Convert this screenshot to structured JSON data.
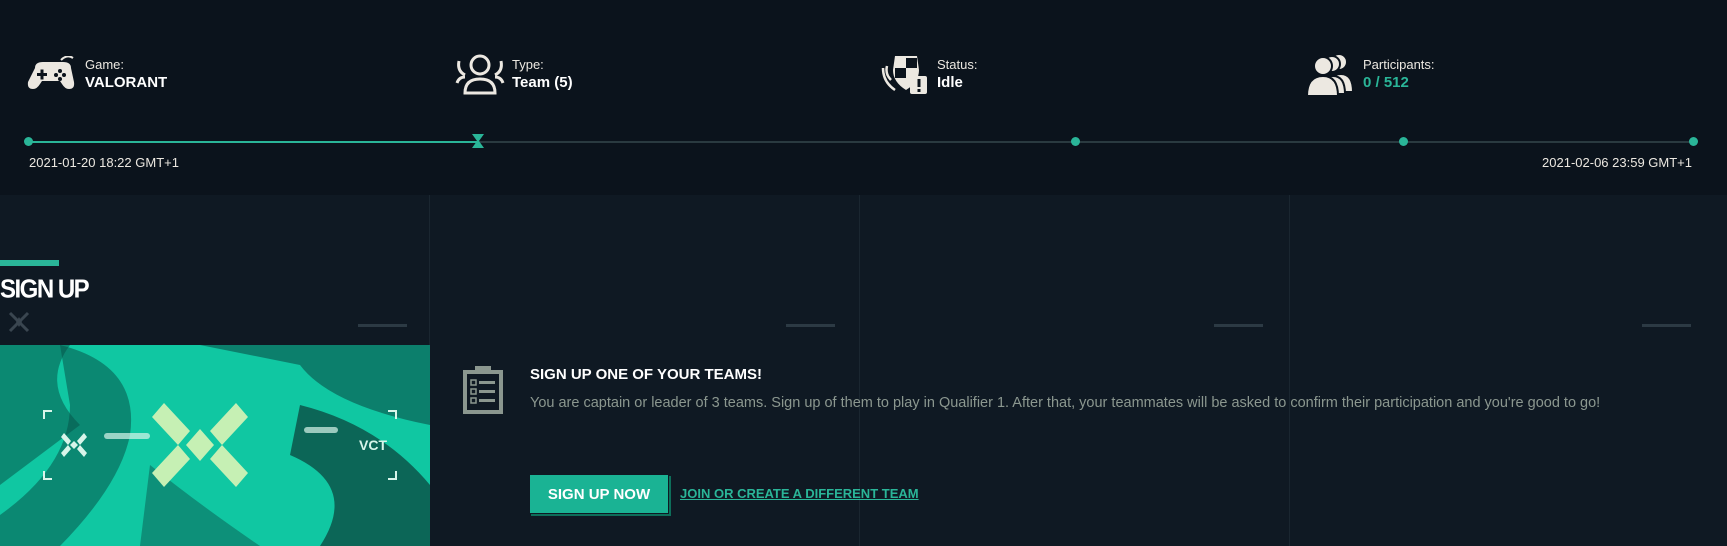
{
  "stats": {
    "game": {
      "label": "Game:",
      "value": "VALORANT",
      "icon": "gamepad-icon"
    },
    "type": {
      "label": "Type:",
      "value": "Team (5)",
      "icon": "team-icon"
    },
    "status": {
      "label": "Status:",
      "value": "Idle",
      "icon": "shield-warning-icon"
    },
    "participants": {
      "label": "Participants:",
      "value": "0 / 512",
      "icon": "participants-icon"
    }
  },
  "timeline": {
    "start": "2021-01-20 18:22 GMT+1",
    "end": "2021-02-06 23:59 GMT+1",
    "progress": 0.27
  },
  "signup": {
    "heading": "SIGN UP",
    "banner_text": "VCT",
    "cta_title": "SIGN UP ONE OF YOUR TEAMS!",
    "cta_description": "You are captain or leader of 3 teams. Sign up of them to play in Qualifier 1. After that, your teammates will be asked to confirm their participation and you're good to go!",
    "button_label": "SIGN UP NOW",
    "link_label": "JOIN OR CREATE A DIFFERENT TEAM"
  },
  "colors": {
    "accent": "#2ab598",
    "background": "#0f1923",
    "header_background": "#0b131c",
    "banner": "#11c4a0"
  }
}
